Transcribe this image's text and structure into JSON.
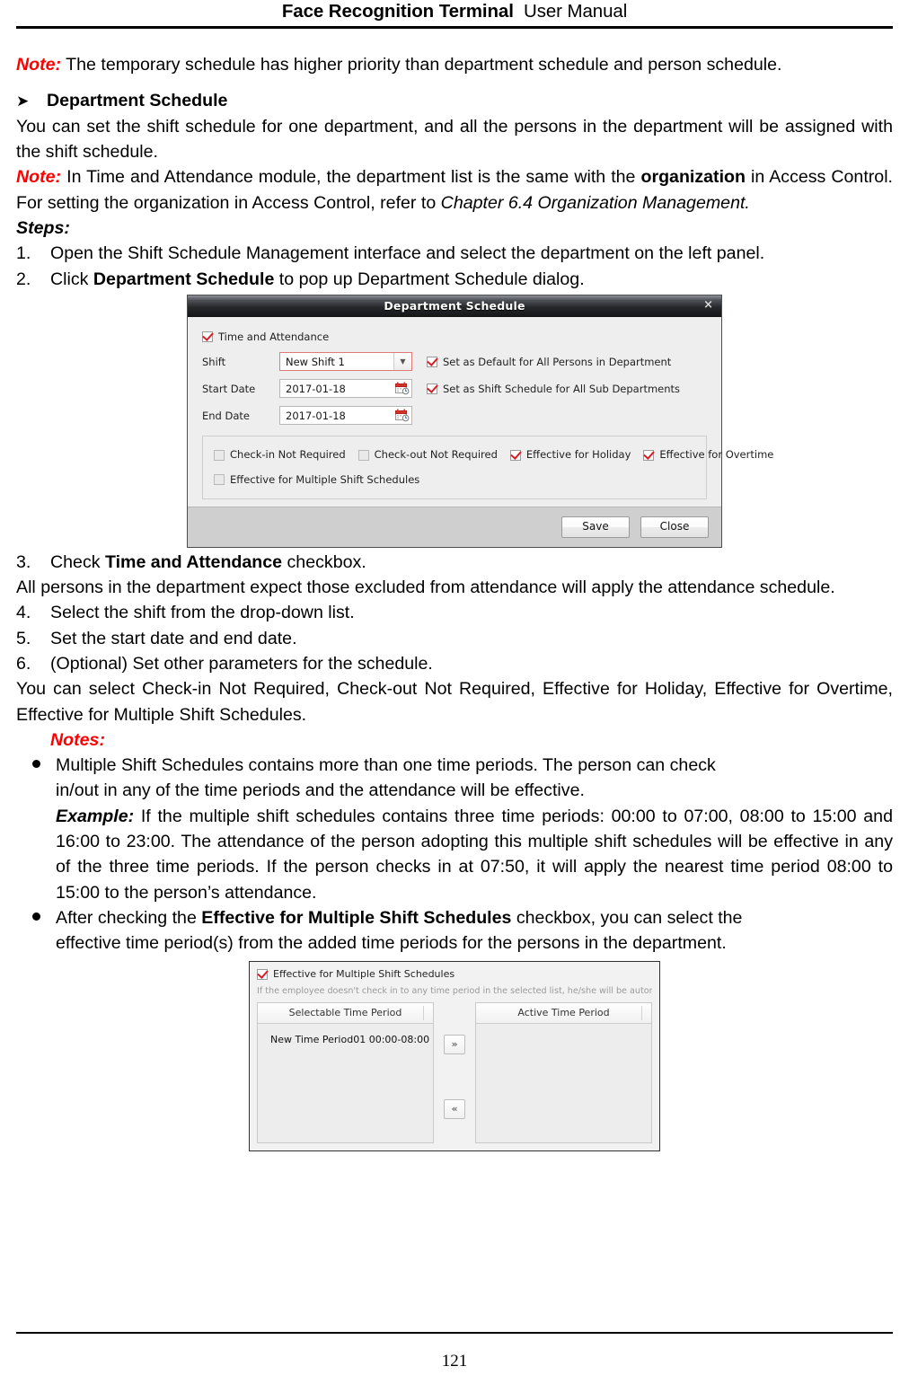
{
  "header": {
    "product": "Face Recognition Terminal",
    "manual": "User Manual"
  },
  "intro_note": {
    "label": "Note:",
    "text": "The temporary schedule has higher priority than department schedule and person schedule."
  },
  "section": {
    "arrow_glyph": "➤",
    "heading": "Department Schedule",
    "para1": "You can set the shift schedule for one department, and all the persons in the department will be assigned with the shift schedule.",
    "note2_label": "Note:",
    "note2_part1": "In Time and Attendance module, the department list is the same with the ",
    "note2_bold": "organization",
    "note2_part2": " in Access Control. For setting the organization in Access Control, refer to ",
    "note2_italic": "Chapter 6.4 Organization Management.",
    "steps_label": "Steps:"
  },
  "steps": [
    {
      "num": "1.",
      "text": "Open the Shift Schedule Management interface and select the department on the left panel."
    },
    {
      "num": "2.",
      "pre": "Click ",
      "bold": "Department Schedule",
      "post": " to pop up Department Schedule dialog."
    },
    {
      "num": "3.",
      "pre": "Check ",
      "bold": "Time and Attendance",
      "post": " checkbox.",
      "sub": "All persons in the department expect those excluded from attendance will apply the attendance schedule."
    },
    {
      "num": "4.",
      "text": "Select the shift from the drop-down list."
    },
    {
      "num": "5.",
      "text": "Set the start date and end date."
    },
    {
      "num": "6.",
      "text": "(Optional) Set other parameters for the schedule.",
      "sub": "You can select Check-in Not Required, Check-out Not Required, Effective for Holiday, Effective for Overtime, Effective for Multiple Shift Schedules."
    }
  ],
  "notes_label": "Notes:",
  "bullets": [
    {
      "line1": "Multiple Shift Schedules contains more than one time periods. The person can check",
      "line2": "in/out in any of the time periods and the attendance will be effective.",
      "example_label": "Example:",
      "example_text": "If the multiple shift schedules contains three time periods: 00:00 to 07:00, 08:00 to 15:00 and 16:00 to 23:00. The attendance of the person adopting this multiple shift schedules will be effective in any of the three time periods. If the person checks in at 07:50, it will apply the nearest time period 08:00 to 15:00 to the person’s attendance."
    },
    {
      "pre": "After checking the ",
      "bold": "Effective for Multiple Shift Schedules",
      "post": " checkbox, you can select the",
      "line2": "effective time period(s) from the added time periods for the persons in the department."
    }
  ],
  "dialog": {
    "title": "Department Schedule",
    "close_glyph": "×",
    "time_attendance": {
      "label": "Time and Attendance",
      "checked": true
    },
    "shift": {
      "label": "Shift",
      "value": "New Shift 1",
      "arrow_glyph": "▼"
    },
    "start_date": {
      "label": "Start Date",
      "value": "2017-01-18"
    },
    "end_date": {
      "label": "End Date",
      "value": "2017-01-18"
    },
    "side_options": [
      {
        "label": "Set as Default for All Persons in Department",
        "checked": true
      },
      {
        "label": "Set as Shift Schedule for All Sub Departments",
        "checked": true
      }
    ],
    "group_options_row1": [
      {
        "label": "Check-in Not Required",
        "checked": false
      },
      {
        "label": "Check-out Not Required",
        "checked": false
      },
      {
        "label": "Effective for Holiday",
        "checked": true
      },
      {
        "label": "Effective for Overtime",
        "checked": true
      }
    ],
    "group_options_row2": [
      {
        "label": "Effective for Multiple Shift Schedules",
        "checked": false
      }
    ],
    "save_label": "Save",
    "close_label": "Close"
  },
  "panel2": {
    "checkbox_label": "Effective for Multiple Shift Schedules",
    "checkbox_checked": true,
    "hint": "If the employee doesn't check in to any time period in the selected list, he/she will be automatically ...",
    "left_header": "Selectable Time Period",
    "right_header": "Active Time Period",
    "left_items": [
      "New Time Period01 00:00-08:00"
    ],
    "right_items": [],
    "add_button_glyph": "»",
    "remove_button_glyph": "«"
  },
  "footer": {
    "page_number": "121"
  },
  "colors": {
    "note_red": "#ff0000",
    "accent_red": "#d61f24",
    "dialog_title_bg": "#26282b",
    "dialog_body_bg": "#efeeee",
    "footer_bg": "#cfcfcf"
  }
}
